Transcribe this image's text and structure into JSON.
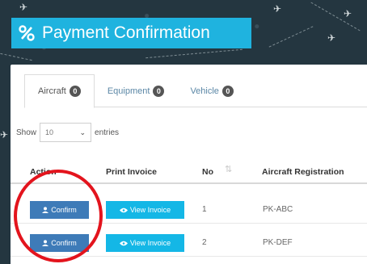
{
  "header": {
    "title": "Payment Confirmation",
    "title_icon": "percent-icon"
  },
  "tabs": [
    {
      "label": "Aircraft",
      "count": "0",
      "active": true
    },
    {
      "label": "Equipment",
      "count": "0",
      "active": false
    },
    {
      "label": "Vehicle",
      "count": "0",
      "active": false
    }
  ],
  "length": {
    "prefix": "Show",
    "value": "10",
    "suffix": "entries"
  },
  "table": {
    "columns": [
      "Action",
      "Print Invoice",
      "No",
      "Aircraft Registration"
    ],
    "rows": [
      {
        "action": "Confirm",
        "invoice": "View Invoice",
        "no": "1",
        "registration": "PK-ABC"
      },
      {
        "action": "Confirm",
        "invoice": "View Invoice",
        "no": "2",
        "registration": "PK-DEF"
      }
    ]
  },
  "colors": {
    "title_bg": "#1fb3df",
    "confirm_button": "#3e7bb8",
    "invoice_button": "#14b7e6",
    "highlight_circle": "#e3141d"
  }
}
